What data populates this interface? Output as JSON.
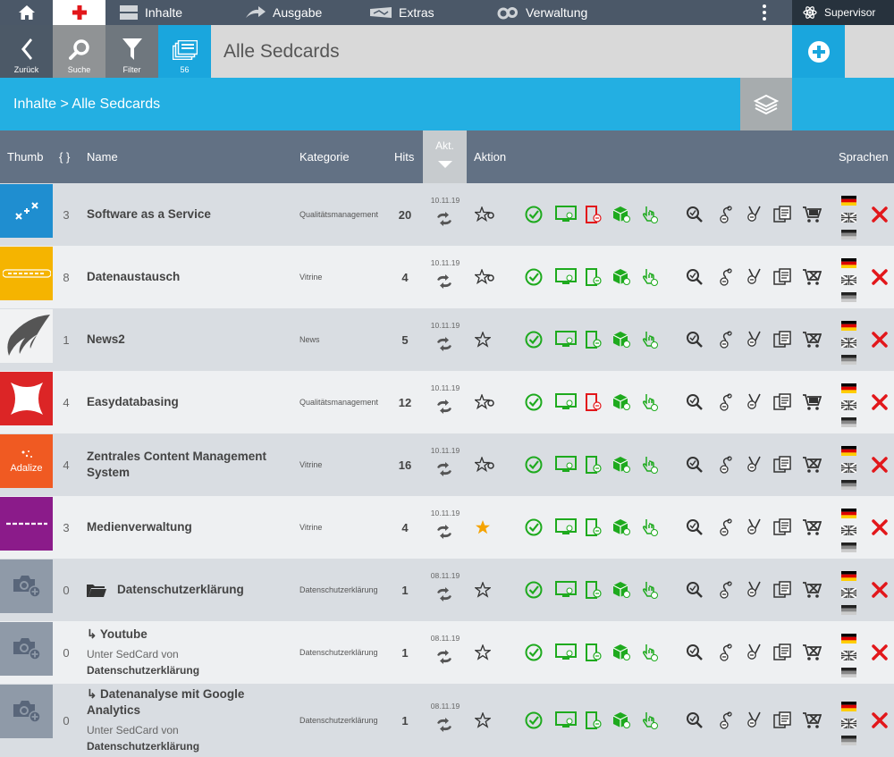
{
  "topnav": {
    "menu": [
      "Inhalte",
      "Ausgabe",
      "Extras",
      "Verwaltung"
    ],
    "user": "Supervisor"
  },
  "toolbar": {
    "back_label": "Zurück",
    "search_label": "Suche",
    "filter_label": "Filter",
    "count": "56",
    "title": "Alle Sedcards"
  },
  "breadcrumb": "Inhalte > Alle Sedcards",
  "columns": {
    "thumb": "Thumb",
    "braces": "{ }",
    "name": "Name",
    "kategorie": "Kategorie",
    "hits": "Hits",
    "akt": "Akt.",
    "aktion": "Aktion",
    "sprachen": "Sprachen"
  },
  "rows": [
    {
      "thumb": "ads",
      "thumb_text": "ADS",
      "num": "3",
      "name": "Software as a Service",
      "kat": "Qualitätsmanagement",
      "hits": "20",
      "date": "10.11.19",
      "star": "star-o",
      "cart": "cart-icon"
    },
    {
      "thumb": "usetheweb-yellow",
      "thumb_text": "use(the)web",
      "num": "8",
      "name": "Datenaustausch",
      "kat": "Vitrine",
      "hits": "4",
      "date": "10.11.19",
      "star": "star-o",
      "cart": "no-cart-icon"
    },
    {
      "thumb": "wing",
      "thumb_text": "",
      "num": "1",
      "name": "News2",
      "kat": "News",
      "hits": "5",
      "date": "10.11.19",
      "star": "star",
      "cart": "no-cart-icon"
    },
    {
      "thumb": "easydb",
      "thumb_text": "",
      "num": "4",
      "name": "Easydatabasing",
      "kat": "Qualitätsmanagement",
      "hits": "12",
      "date": "10.11.19",
      "star": "star-o",
      "cart": "cart-icon"
    },
    {
      "thumb": "adalize",
      "thumb_text": "Adalize",
      "num": "4",
      "name": "Zentrales Content Management System",
      "kat": "Vitrine",
      "hits": "16",
      "date": "10.11.19",
      "star": "star-o",
      "cart": "no-cart-icon"
    },
    {
      "thumb": "usetheweb-purple",
      "thumb_text": "use(the)web",
      "num": "3",
      "name": "Medienverwaltung",
      "kat": "Vitrine",
      "hits": "4",
      "date": "10.11.19",
      "star": "star-filled",
      "cart": "no-cart-icon"
    },
    {
      "thumb": "camera",
      "thumb_text": "",
      "num": "0",
      "name": "Datenschutzerklärung",
      "kat": "Datenschutzerklärung",
      "hits": "1",
      "date": "08.11.19",
      "star": "star",
      "cart": "no-cart-icon",
      "folder": true
    },
    {
      "thumb": "camera",
      "thumb_text": "",
      "num": "0",
      "name": "↳ Youtube",
      "sub": "Unter SedCard von",
      "subb": "Datenschutzerklärung",
      "kat": "Datenschutzerklärung",
      "hits": "1",
      "date": "08.11.19",
      "star": "star",
      "cart": "no-cart-icon"
    },
    {
      "thumb": "camera",
      "thumb_text": "",
      "num": "0",
      "name": "↳ Datenanalyse mit Google Analytics",
      "sub": "Unter SedCard von",
      "subb": "Datenschutzerklärung",
      "kat": "Datenschutzerklärung",
      "hits": "1",
      "date": "08.11.19",
      "star": "star",
      "cart": "no-cart-icon"
    }
  ],
  "colors": {
    "accent": "#23afe2",
    "nav": "#4b5868",
    "header": "#627184",
    "green": "#1eaa1e",
    "red": "#e2171b"
  }
}
